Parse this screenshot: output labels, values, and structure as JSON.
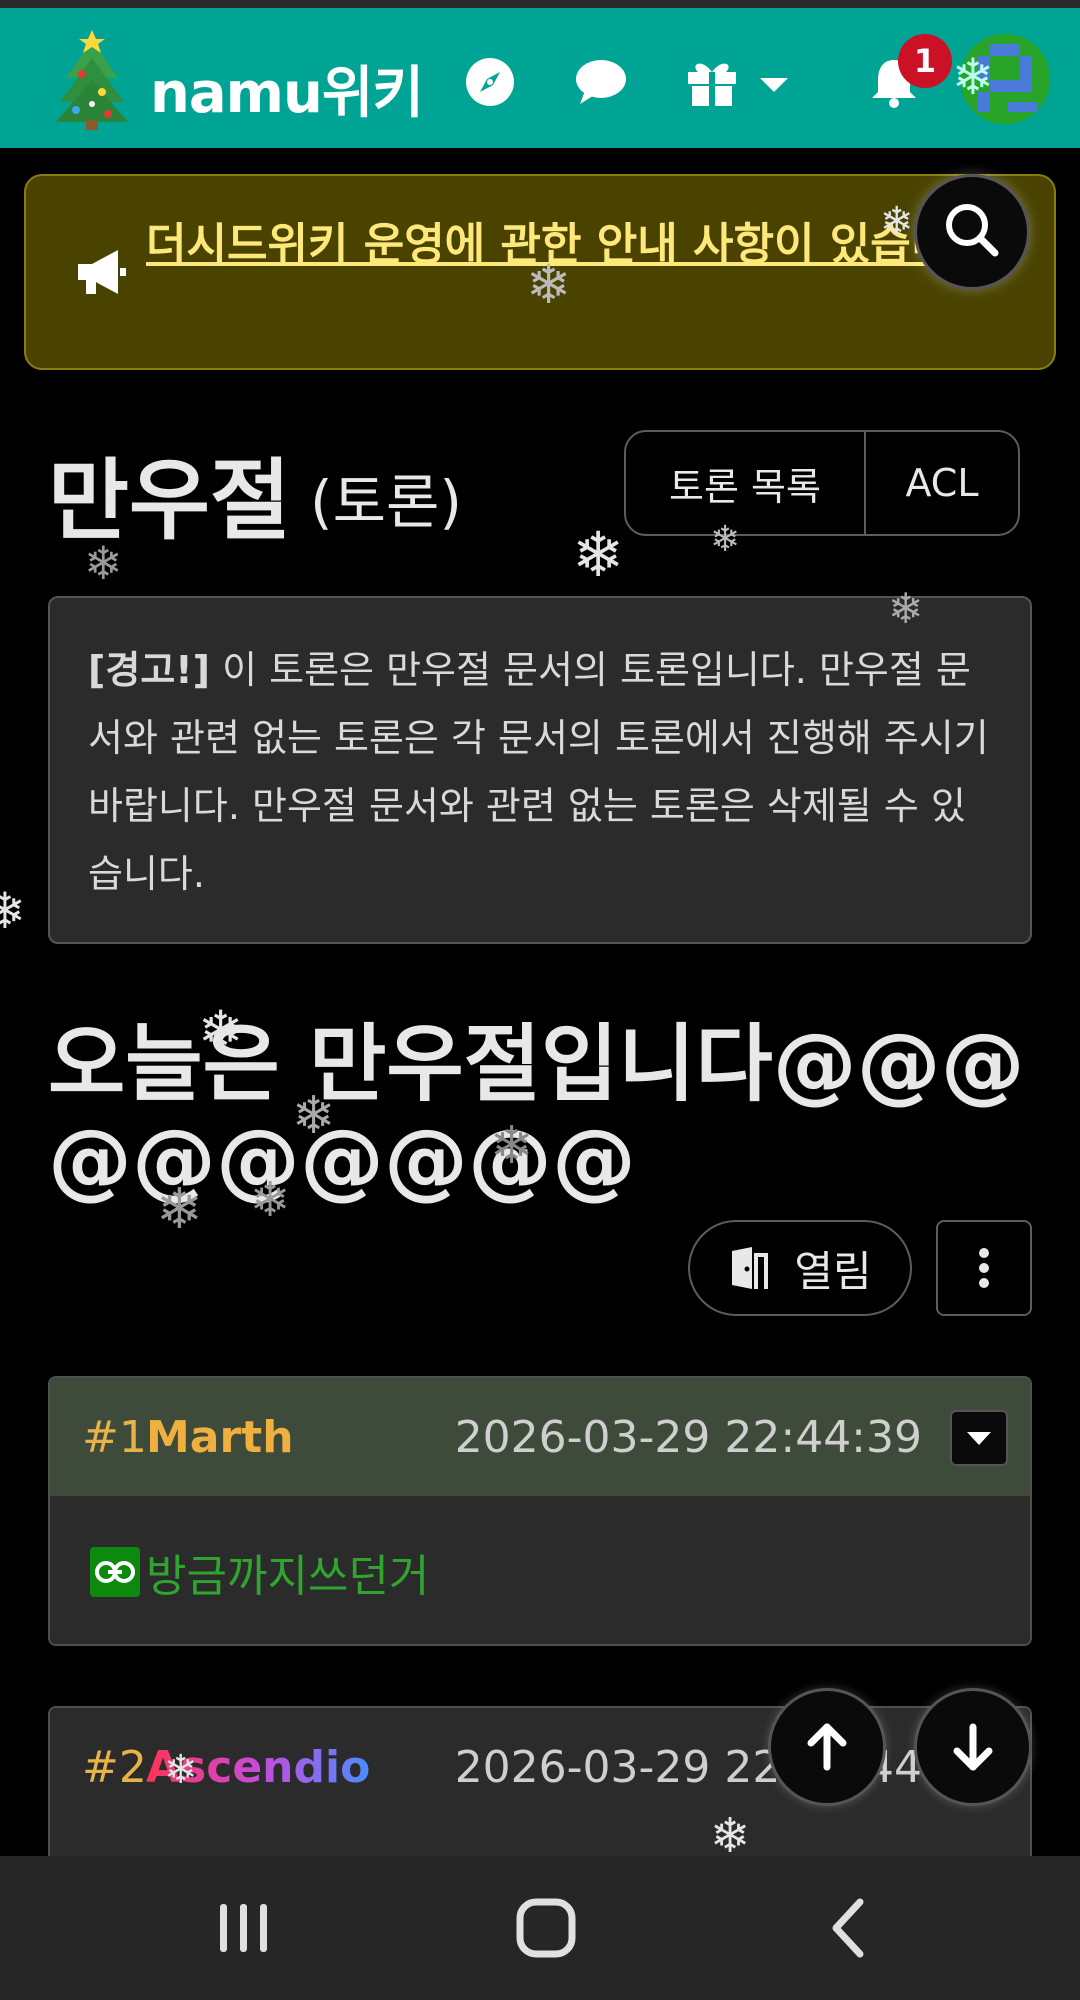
{
  "header": {
    "brand": "namu위키",
    "notification_count": "1",
    "icons": [
      "christmas-tree-icon",
      "compass-icon",
      "chat-bubble-icon",
      "gift-icon",
      "caret-down-icon",
      "bell-icon"
    ],
    "accent_color": "#00a495"
  },
  "notice": {
    "text": "더시드위키 운영에 관한 안내 사항이 있습니다.",
    "icon": "megaphone-icon"
  },
  "page": {
    "title": "만우절",
    "title_suffix": "(토론)",
    "buttons": [
      "토론 목록",
      "ACL"
    ]
  },
  "warning": {
    "label": "[경고!]",
    "text": " 이 토론은 만우절 문서의 토론입니다. 만우절 문서와 관련 없는 토론은 각 문서의 토론에서 진행해 주시기 바랍니다. 만우절 문서와 관련 없는 토론은 삭제될 수 있습니다."
  },
  "thread": {
    "title": "오늘은 만우절입니다@@@@@@@@@@",
    "status": "열림"
  },
  "comments": [
    {
      "number": "#1",
      "user": "Marth",
      "time": "2026-03-29 22:44:39",
      "link_text": "방금까지쓰던거"
    },
    {
      "number": "#2",
      "user": "Ascendio",
      "time": "2026-03-29 22:54:44"
    }
  ],
  "system_nav": [
    "recent-apps-icon",
    "home-icon",
    "back-icon"
  ]
}
